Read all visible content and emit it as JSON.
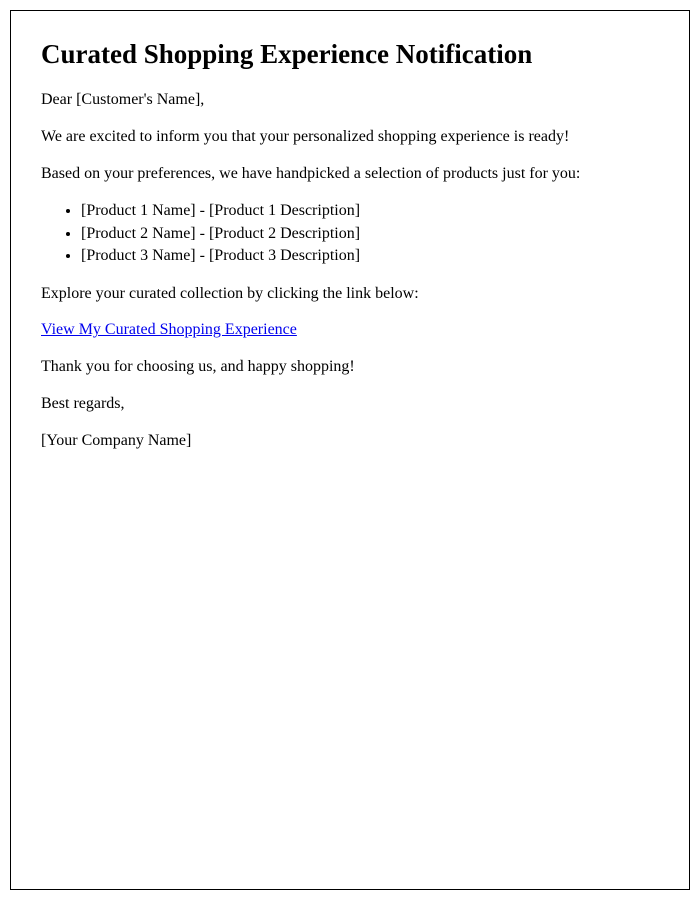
{
  "title": "Curated Shopping Experience Notification",
  "greeting": "Dear [Customer's Name],",
  "intro": "We are excited to inform you that your personalized shopping experience is ready!",
  "preface": "Based on your preferences, we have handpicked a selection of products just for you:",
  "products": [
    "[Product 1 Name] - [Product 1 Description]",
    "[Product 2 Name] - [Product 2 Description]",
    "[Product 3 Name] - [Product 3 Description]"
  ],
  "explore": "Explore your curated collection by clicking the link below:",
  "link_text": "View My Curated Shopping Experience",
  "thankyou": "Thank you for choosing us, and happy shopping!",
  "regards": "Best regards,",
  "company": "[Your Company Name]"
}
